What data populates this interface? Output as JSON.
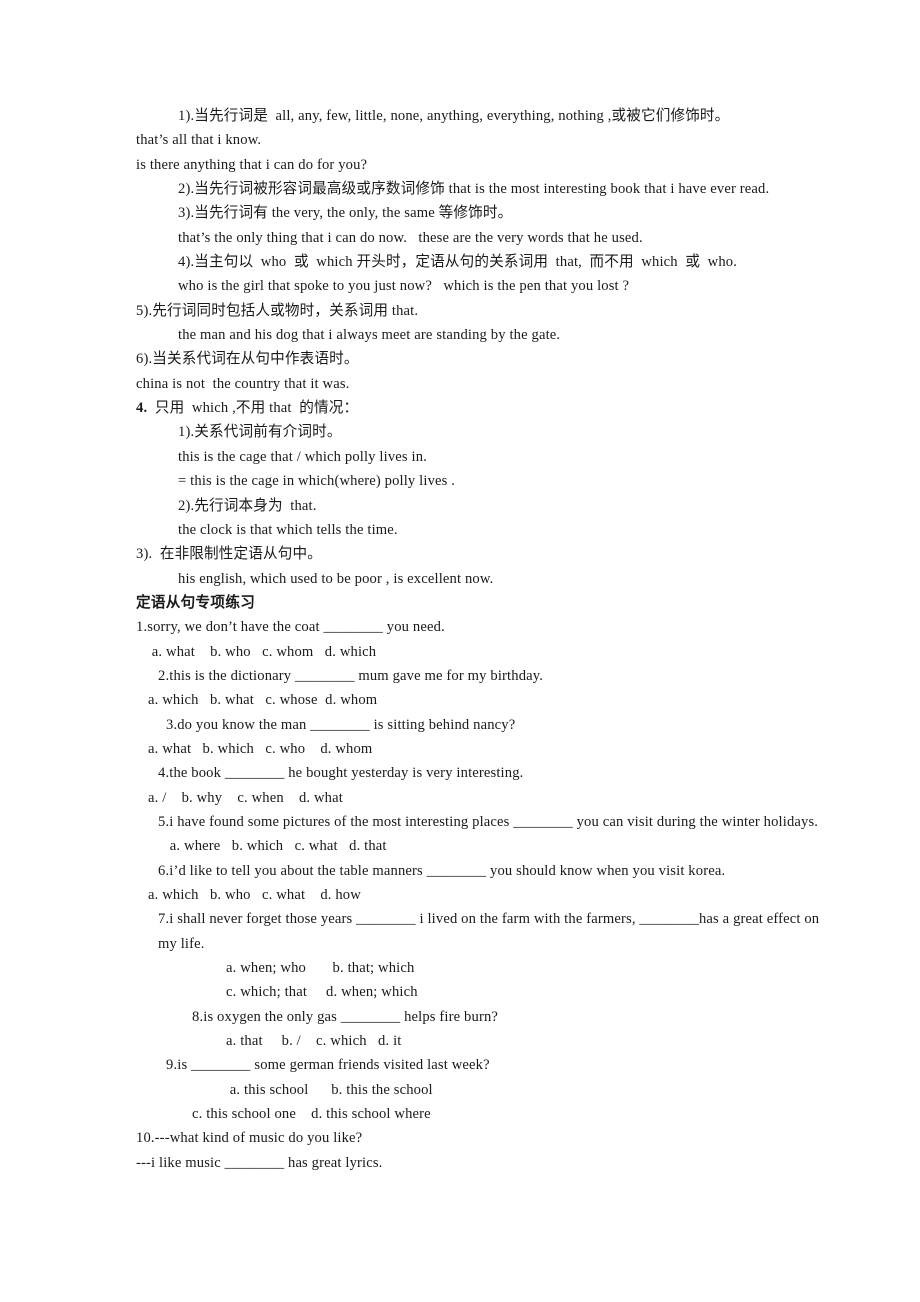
{
  "document": {
    "notes_section": {
      "lines": [
        {
          "id": "n1",
          "indent": 4,
          "text": "1).当先行词是  all, any, few, little, none, anything, everything, nothing ,或被它们修饰时。"
        },
        {
          "id": "n2",
          "indent": 0,
          "text": "that’s all that i know."
        },
        {
          "id": "n3",
          "indent": 0,
          "text": "is there anything that i can do for you?"
        },
        {
          "id": "n4",
          "indent": 4,
          "text": "2).当先行词被形容词最高级或序数词修饰 that is the most interesting book that i have ever read."
        },
        {
          "id": "n5",
          "indent": 4,
          "text": "3).当先行词有 the very, the only, the same 等修饰时。"
        },
        {
          "id": "n6",
          "indent": 4,
          "text": "that’s the only thing that i can do now.   these are the very words that he used."
        },
        {
          "id": "n7",
          "indent": 4,
          "text": "4).当主句以  who  或  which 开头时，定语从句的关系词用  that,  而不用  which  或  who."
        },
        {
          "id": "n8",
          "indent": 4,
          "text": "who is the girl that spoke to you just now?   which is the pen that you lost ?"
        },
        {
          "id": "n9",
          "indent": 0,
          "text": "5).先行词同时包括人或物时，关系词用 that."
        },
        {
          "id": "n10",
          "indent": 4,
          "text": "the man and his dog that i always meet are standing by the gate."
        },
        {
          "id": "n11",
          "indent": 0,
          "text": "6).当关系代词在从句中作表语时。"
        },
        {
          "id": "n12",
          "indent": 0,
          "text": "china is not  the country that it was."
        }
      ],
      "rule4": {
        "indent": 0,
        "number": "4.",
        "text": "  只用  which ,不用 that  的情况："
      },
      "rule4_lines": [
        {
          "id": "r1",
          "indent": 4,
          "text": "1).关系代词前有介词时。"
        },
        {
          "id": "r2",
          "indent": 4,
          "text": "this is the cage that / which polly lives in."
        },
        {
          "id": "r3",
          "indent": 4,
          "text": "= this is the cage in which(where) polly lives ."
        },
        {
          "id": "r4",
          "indent": 4,
          "text": "2).先行词本身为  that."
        },
        {
          "id": "r5",
          "indent": 4,
          "text": "the clock is that which tells the time."
        },
        {
          "id": "r6",
          "indent": 0,
          "text": "3).  在非限制性定语从句中。"
        },
        {
          "id": "r7",
          "indent": 4,
          "text": "his english, which used to be poor , is excellent now."
        }
      ]
    },
    "exercise_section": {
      "heading": "定语从句专项练习",
      "items": [
        {
          "id": "q1",
          "indent": 0,
          "text": "1.sorry, we don’t have the coat ________ you need."
        },
        {
          "id": "q1o",
          "indent": 1,
          "text": " a. what    b. who   c. whom   d. which"
        },
        {
          "id": "q2",
          "indent": 2,
          "text": "2.this is the dictionary ________ mum gave me for my birthday."
        },
        {
          "id": "q2o",
          "indent": 1,
          "text": "a. which   b. what   c. whose  d. whom"
        },
        {
          "id": "q3",
          "indent": 3,
          "text": "3.do you know the man ________ is sitting behind nancy?"
        },
        {
          "id": "q3o",
          "indent": 1,
          "text": "a. what   b. which   c. who    d. whom"
        },
        {
          "id": "q4",
          "indent": 2,
          "text": "4.the book ________ he bought yesterday is very interesting."
        },
        {
          "id": "q4o",
          "indent": 1,
          "text": "a. /    b. why    c. when    d. what"
        },
        {
          "id": "q5",
          "indent": 2,
          "text": "5.i have found some pictures of the most interesting places ________ you can visit during the winter holidays."
        },
        {
          "id": "q5o",
          "indent": 3,
          "text": " a. where   b. which   c. what   d. that"
        },
        {
          "id": "q6",
          "indent": 2,
          "text": "6.i’d like to tell you about the table manners ________ you should know when you visit korea."
        },
        {
          "id": "q6o",
          "indent": 1,
          "text": "a. which   b. who   c. what    d. how"
        },
        {
          "id": "q7",
          "indent": 2,
          "text": "7.i shall never forget those years ________ i lived on the farm with the farmers, ________has a great effect on my life."
        },
        {
          "id": "q7oa",
          "indent": 6,
          "text": "a. when; who       b. that; which"
        },
        {
          "id": "q7ob",
          "indent": 6,
          "text": "c. which; that     d. when; which"
        },
        {
          "id": "q8",
          "indent": 5,
          "text": "8.is oxygen the only gas ________ helps fire burn?"
        },
        {
          "id": "q8o",
          "indent": 6,
          "text": "a. that     b. /    c. which   d. it"
        },
        {
          "id": "q9",
          "indent": 3,
          "text": "9.is ________ some german friends visited last week?"
        },
        {
          "id": "q9oa",
          "indent": 6,
          "text": " a. this school      b. this the school"
        },
        {
          "id": "q9ob",
          "indent": 5,
          "text": "c. this school one    d. this school where"
        },
        {
          "id": "q10",
          "indent": 0,
          "text": "10.---what kind of music do you like?"
        },
        {
          "id": "q10b",
          "indent": 0,
          "text": "---i like music ________ has great lyrics."
        }
      ]
    }
  }
}
